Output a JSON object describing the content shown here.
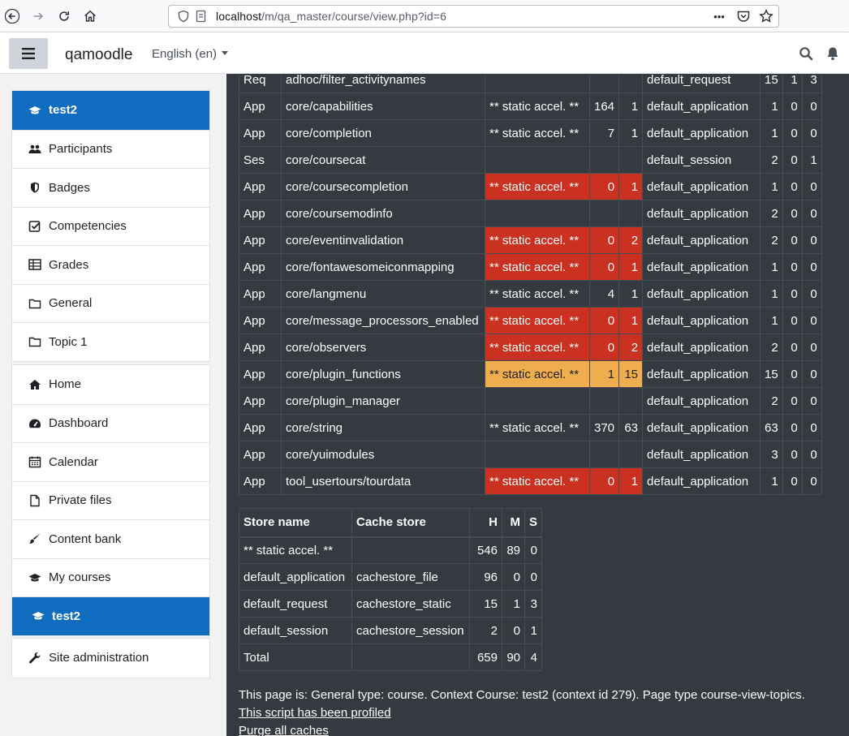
{
  "browser": {
    "url_host": "localhost",
    "url_path": "/m/qa_master/course/view.php?id=6",
    "more_label": "•••"
  },
  "navbar": {
    "brand": "qamoodle",
    "language": "English (en)"
  },
  "sidebar": {
    "course_group": [
      {
        "label": "test2",
        "icon": "graduation-cap-icon",
        "active": true
      },
      {
        "label": "Participants",
        "icon": "users-icon"
      },
      {
        "label": "Badges",
        "icon": "shield-icon"
      },
      {
        "label": "Competencies",
        "icon": "check-square-icon"
      },
      {
        "label": "Grades",
        "icon": "table-icon"
      },
      {
        "label": "General",
        "icon": "folder-icon"
      },
      {
        "label": "Topic 1",
        "icon": "folder-icon"
      }
    ],
    "site_group": [
      {
        "label": "Home",
        "icon": "home-icon"
      },
      {
        "label": "Dashboard",
        "icon": "tachometer-icon"
      },
      {
        "label": "Calendar",
        "icon": "calendar-icon"
      },
      {
        "label": "Private files",
        "icon": "file-icon"
      },
      {
        "label": "Content bank",
        "icon": "paint-brush-icon"
      },
      {
        "label": "My courses",
        "icon": "graduation-cap-icon"
      },
      {
        "label": "test2",
        "icon": "graduation-cap-icon",
        "active": true
      }
    ],
    "admin_group": [
      {
        "label": "Site administration",
        "icon": "wrench-icon"
      }
    ]
  },
  "cache_rows": [
    {
      "mode": "Req",
      "def": "adhoc/filter_activitynames",
      "store": "",
      "h": "",
      "m": "",
      "target": "default_request",
      "th": "15",
      "tm": "1",
      "ts": "3",
      "hl": ""
    },
    {
      "mode": "App",
      "def": "core/capabilities",
      "store": "** static accel. **",
      "h": "164",
      "m": "1",
      "target": "default_application",
      "th": "1",
      "tm": "0",
      "ts": "0",
      "hl": ""
    },
    {
      "mode": "App",
      "def": "core/completion",
      "store": "** static accel. **",
      "h": "7",
      "m": "1",
      "target": "default_application",
      "th": "1",
      "tm": "0",
      "ts": "0",
      "hl": ""
    },
    {
      "mode": "Ses",
      "def": "core/coursecat",
      "store": "",
      "h": "",
      "m": "",
      "target": "default_session",
      "th": "2",
      "tm": "0",
      "ts": "1",
      "hl": ""
    },
    {
      "mode": "App",
      "def": "core/coursecompletion",
      "store": "** static accel. **",
      "h": "0",
      "m": "1",
      "target": "default_application",
      "th": "1",
      "tm": "0",
      "ts": "0",
      "hl": "red"
    },
    {
      "mode": "App",
      "def": "core/coursemodinfo",
      "store": "",
      "h": "",
      "m": "",
      "target": "default_application",
      "th": "2",
      "tm": "0",
      "ts": "0",
      "hl": ""
    },
    {
      "mode": "App",
      "def": "core/eventinvalidation",
      "store": "** static accel. **",
      "h": "0",
      "m": "2",
      "target": "default_application",
      "th": "2",
      "tm": "0",
      "ts": "0",
      "hl": "red"
    },
    {
      "mode": "App",
      "def": "core/fontawesomeiconmapping",
      "store": "** static accel. **",
      "h": "0",
      "m": "1",
      "target": "default_application",
      "th": "1",
      "tm": "0",
      "ts": "0",
      "hl": "red"
    },
    {
      "mode": "App",
      "def": "core/langmenu",
      "store": "** static accel. **",
      "h": "4",
      "m": "1",
      "target": "default_application",
      "th": "1",
      "tm": "0",
      "ts": "0",
      "hl": ""
    },
    {
      "mode": "App",
      "def": "core/message_processors_enabled",
      "store": "** static accel. **",
      "h": "0",
      "m": "1",
      "target": "default_application",
      "th": "1",
      "tm": "0",
      "ts": "0",
      "hl": "red"
    },
    {
      "mode": "App",
      "def": "core/observers",
      "store": "** static accel. **",
      "h": "0",
      "m": "2",
      "target": "default_application",
      "th": "2",
      "tm": "0",
      "ts": "0",
      "hl": "red"
    },
    {
      "mode": "App",
      "def": "core/plugin_functions",
      "store": "** static accel. **",
      "h": "1",
      "m": "15",
      "target": "default_application",
      "th": "15",
      "tm": "0",
      "ts": "0",
      "hl": "orange"
    },
    {
      "mode": "App",
      "def": "core/plugin_manager",
      "store": "",
      "h": "",
      "m": "",
      "target": "default_application",
      "th": "2",
      "tm": "0",
      "ts": "0",
      "hl": ""
    },
    {
      "mode": "App",
      "def": "core/string",
      "store": "** static accel. **",
      "h": "370",
      "m": "63",
      "target": "default_application",
      "th": "63",
      "tm": "0",
      "ts": "0",
      "hl": ""
    },
    {
      "mode": "App",
      "def": "core/yuimodules",
      "store": "",
      "h": "",
      "m": "",
      "target": "default_application",
      "th": "3",
      "tm": "0",
      "ts": "0",
      "hl": ""
    },
    {
      "mode": "App",
      "def": "tool_usertours/tourdata",
      "store": "** static accel. **",
      "h": "0",
      "m": "1",
      "target": "default_application",
      "th": "1",
      "tm": "0",
      "ts": "0",
      "hl": "red"
    }
  ],
  "store_table": {
    "headers": [
      "Store name",
      "Cache store",
      "H",
      "M",
      "S"
    ],
    "rows": [
      [
        "** static accel. **",
        "",
        "546",
        "89",
        "0"
      ],
      [
        "default_application",
        "cachestore_file",
        "96",
        "0",
        "0"
      ],
      [
        "default_request",
        "cachestore_static",
        "15",
        "1",
        "3"
      ],
      [
        "default_session",
        "cachestore_session",
        "2",
        "0",
        "1"
      ],
      [
        "Total",
        "",
        "659",
        "90",
        "4"
      ]
    ]
  },
  "footer": {
    "page_info": "This page is: General type: course. Context Course: test2 (context id 279). Page type course-view-topics.",
    "profiled_link": "This script has been profiled",
    "purge_link": "Purge all caches"
  },
  "colors": {
    "accent": "#0f6cbf",
    "dark_bg": "#343a40",
    "miss_red": "#ca3120",
    "warn_orange": "#f0ad4e"
  }
}
